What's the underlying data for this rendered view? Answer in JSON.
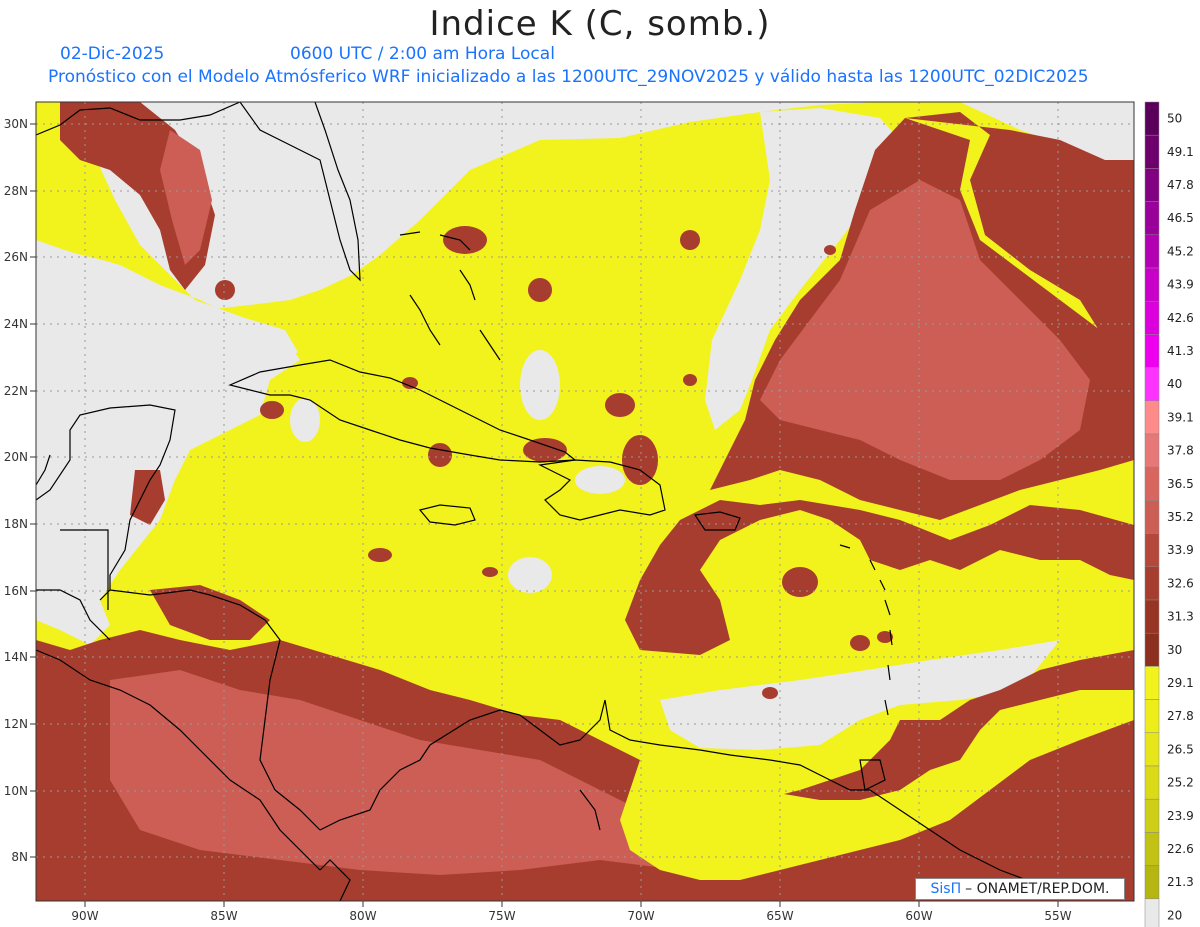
{
  "header": {
    "title": "Indice K (C, somb.)",
    "date": "02-Dic-2025",
    "time": "0600 UTC / 2:00 am Hora Local",
    "description": "Pronóstico con el Modelo Atmósferico WRF inicializado a las 1200UTC_29NOV2025 y válido hasta las  1200UTC_02DIC2025"
  },
  "map": {
    "lon_labels": [
      "90W",
      "85W",
      "80W",
      "75W",
      "70W",
      "65W",
      "60W",
      "55W"
    ],
    "lat_labels": [
      "30N",
      "28N",
      "26N",
      "24N",
      "22N",
      "20N",
      "18N",
      "16N",
      "14N",
      "12N",
      "10N",
      "8N"
    ],
    "colors": {
      "background": "#e9e9e9",
      "yellow": "#f2f21c",
      "yellow_dark": "#e4e41a",
      "brown_dark": "#8c2f1f",
      "brown_mid": "#b5483b",
      "brown_light": "#cc5e55",
      "coast": "#000000"
    }
  },
  "legend": {
    "values": [
      "50",
      "49.1",
      "47.8",
      "46.5",
      "45.2",
      "43.9",
      "42.6",
      "41.3",
      "40",
      "39.1",
      "37.8",
      "36.5",
      "35.2",
      "33.9",
      "32.6",
      "31.3",
      "30",
      "29.1",
      "27.8",
      "26.5",
      "25.2",
      "23.9",
      "22.6",
      "21.3",
      "20"
    ],
    "colors": [
      "#5a005a",
      "#6e006e",
      "#820082",
      "#9a009a",
      "#b200b2",
      "#c800c8",
      "#dc00dc",
      "#ee00ee",
      "#ff33ff",
      "#ff8a8a",
      "#e87878",
      "#d8665e",
      "#cc5e55",
      "#b5483b",
      "#a63d2e",
      "#983424",
      "#8c2f1f",
      "#f2f21c",
      "#eded1a",
      "#e6e61a",
      "#dada18",
      "#cece16",
      "#c2c214",
      "#b6b612",
      "#e9e9e9"
    ]
  },
  "credit": {
    "sis": "SisΠ",
    "text": "– ONAMET/REP.DOM."
  }
}
